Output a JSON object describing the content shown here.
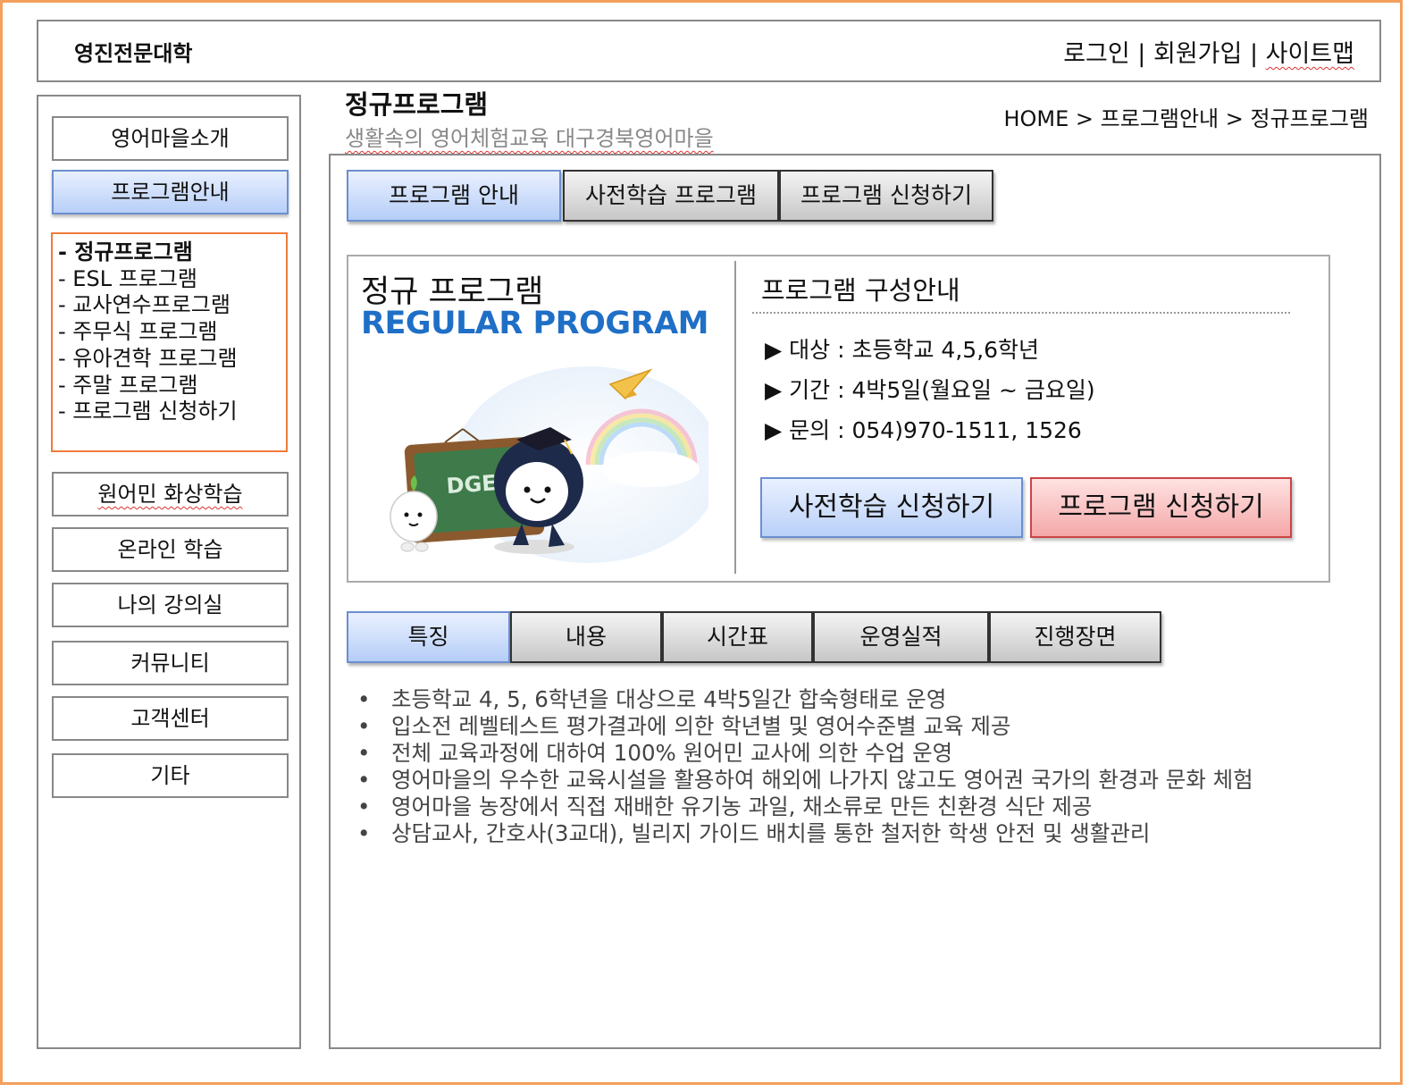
{
  "header": {
    "site_title": "영진전문대학",
    "login": "로그인",
    "separator": " | ",
    "signup": "회원가입",
    "sitemap": "사이트맵"
  },
  "sidebar": {
    "items": [
      {
        "label": "영어마을소개"
      },
      {
        "label": "프로그램안내"
      },
      {
        "label": "원어민 화상학습"
      },
      {
        "label": "온라인 학습"
      },
      {
        "label": "나의 강의실"
      },
      {
        "label": "커뮤니티"
      },
      {
        "label": "고객센터"
      },
      {
        "label": "기타"
      }
    ],
    "submenu": [
      "- 정규프로그램",
      "- ESL 프로그램",
      "- 교사연수프로그램",
      "- 주무식 프로그램",
      "- 유아견학 프로그램",
      "- 주말 프로그램",
      "- 프로그램 신청하기"
    ]
  },
  "page": {
    "title": "정규프로그램",
    "subtitle": "생활속의 영어체험교육 대구경북영어마을",
    "breadcrumb": "HOME > 프로그램안내 > 정규프로그램"
  },
  "top_tabs": [
    "프로그램 안내",
    "사전학습 프로그램",
    "프로그램 신청하기"
  ],
  "program_card": {
    "title_ko": "정규 프로그램",
    "title_en": "REGULAR PROGRAM",
    "board_text": "DGEV",
    "info_title": "프로그램 구성안내",
    "info": [
      "▶ 대상 : 초등학교 4,5,6학년",
      "▶ 기간 : 4박5일(월요일 ~ 금요일)",
      "▶ 문의 : 054)970-1511, 1526"
    ],
    "pre_study_button": "사전학습 신청하기",
    "apply_button": "프로그램 신청하기"
  },
  "sub_tabs": [
    "특징",
    "내용",
    "시간표",
    "운영실적",
    "진행장면"
  ],
  "features": [
    "초등학교 4, 5, 6학년을 대상으로 4박5일간 합숙형태로 운영",
    "입소전 레벨테스트 평가결과에 의한 학년별 및 영어수준별 교육 제공",
    "전체 교육과정에 대하여 100% 원어민 교사에 의한 수업 운영",
    "영어마을의 우수한 교육시설을 활용하여 해외에 나가지 않고도 영어권 국가의 환경과 문화 체험",
    "영어마을 농장에서 직접 재배한 유기농 과일, 채소류로 만든 친환경 식단 제공",
    "상담교사, 간호사(3교대), 빌리지 가이드 배치를 통한 철저한 학생 안전 및 생활관리"
  ],
  "colors": {
    "frame": "#f4a05c",
    "submenu_border": "#f07a3a",
    "accent_blue": "#1f6fc6",
    "active_tab": "#b5cdf7",
    "apply_red": "#f4a8a8"
  }
}
